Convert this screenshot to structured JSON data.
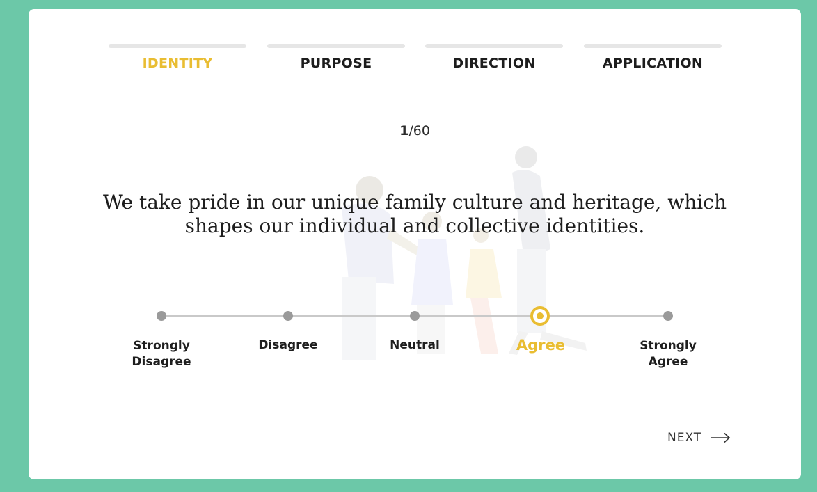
{
  "tabs": [
    {
      "label": "IDENTITY",
      "active": true
    },
    {
      "label": "PURPOSE",
      "active": false
    },
    {
      "label": "DIRECTION",
      "active": false
    },
    {
      "label": "APPLICATION",
      "active": false
    }
  ],
  "progress": {
    "current": "1",
    "total": "/60"
  },
  "question": "We take pride in our unique family culture and heritage, which shapes our individual and collective identities.",
  "scale": {
    "options": [
      {
        "line1": "Strongly",
        "line2": "Disagree"
      },
      {
        "line1": "Disagree",
        "line2": ""
      },
      {
        "line1": "Neutral",
        "line2": ""
      },
      {
        "line1": "Agree",
        "line2": ""
      },
      {
        "line1": "Strongly",
        "line2": "Agree"
      }
    ],
    "selected": "Agree"
  },
  "next_label": "NEXT",
  "colors": {
    "accent": "#e9bd32",
    "background": "#6cc8a8",
    "track": "#c9c9c9",
    "dot": "#9a9a9a"
  },
  "icons": {
    "next": "arrow-right-icon",
    "illustration": "family-walking-illustration"
  }
}
